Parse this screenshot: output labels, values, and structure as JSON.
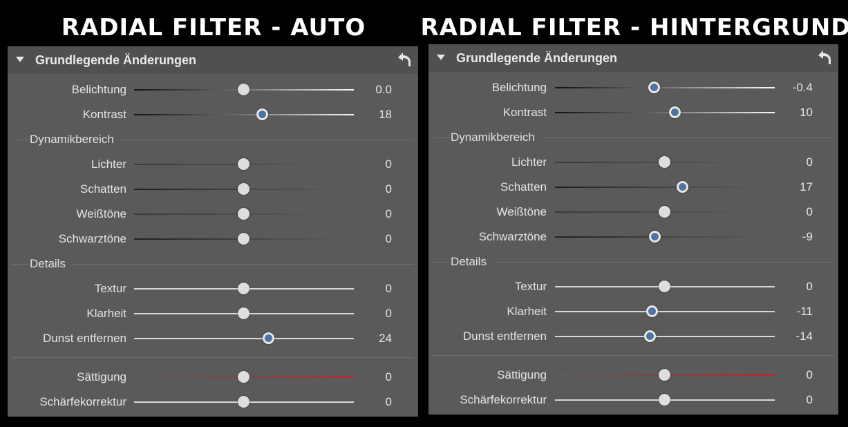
{
  "left": {
    "heading": "RADIAL FILTER - AUTO",
    "panel_title": "Grundlegende Änderungen",
    "values": {
      "belichtung": "0.0",
      "kontrast": "18",
      "lichter": "0",
      "schatten": "0",
      "weisstoene": "0",
      "schwarztoene": "0",
      "textur": "0",
      "klarheit": "0",
      "dunst": "24",
      "saettigung": "0",
      "schaerfe": "0"
    }
  },
  "right": {
    "heading": "RADIAL FILTER - HINTERGRUND",
    "panel_title": "Grundlegende Änderungen",
    "values": {
      "belichtung": "-0.4",
      "kontrast": "10",
      "lichter": "0",
      "schatten": "17",
      "weisstoene": "0",
      "schwarztoene": "-9",
      "textur": "0",
      "klarheit": "-11",
      "dunst": "-14",
      "saettigung": "0",
      "schaerfe": "0"
    }
  },
  "labels": {
    "belichtung": "Belichtung",
    "kontrast": "Kontrast",
    "dynamikbereich": "Dynamikbereich",
    "lichter": "Lichter",
    "schatten": "Schatten",
    "weisstoene": "Weißtöne",
    "schwarztoene": "Schwarztöne",
    "details": "Details",
    "textur": "Textur",
    "klarheit": "Klarheit",
    "dunst": "Dunst entfernen",
    "saettigung": "Sättigung",
    "schaerfe": "Schärfekorrektur"
  },
  "icons": {
    "collapse": "triangle-down-icon",
    "reset": "reset-arrow-icon"
  },
  "colors": {
    "panel_background": "#5a5a5a",
    "header_background": "#505050",
    "changed_thumb": "#4d74a2",
    "saturation_track": "#d11d1d"
  }
}
